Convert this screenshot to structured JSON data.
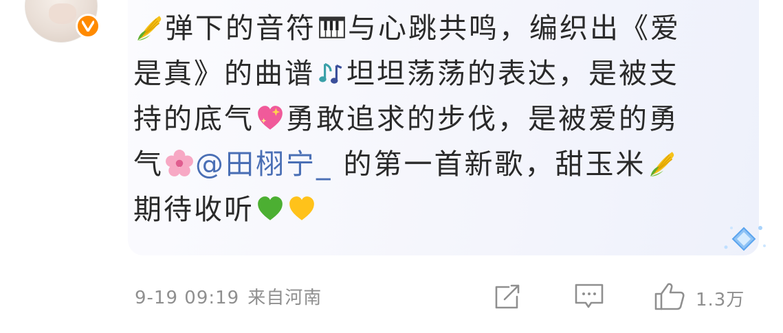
{
  "comment": {
    "lines": [
      [
        "",
        "弹下的音符",
        "",
        "与心跳共鸣，编织出《爱"
      ],
      [
        "是真》的曲谱",
        "",
        "坦坦荡荡的表达，是被支"
      ],
      [
        "持的底气",
        "",
        "勇敢追求的步伐，是被爱的勇"
      ],
      [
        "气",
        "",
        "@田栩宁_",
        " 的第一首新歌，甜玉米",
        ""
      ],
      [
        "期待收听",
        "",
        ""
      ]
    ],
    "line1_seg1": "弹下的音符",
    "line1_seg2": "与心跳共鸣，编织出《爱",
    "line2_seg1": "是真》的曲谱",
    "line2_seg2": "坦坦荡荡的表达，是被支",
    "line3_seg1": "持的底气",
    "line3_seg2": "勇敢追求的步伐，是被爱的勇",
    "line4_seg1": "气",
    "mention": "@田栩宁_",
    "line4_seg2": " 的第一首新歌，甜玉米",
    "line5_seg1": "期待收听",
    "emojis": [
      "corn-emoji",
      "piano-keys-emoji",
      "music-notes-emoji",
      "sparkling-heart-emoji",
      "cherry-blossom-emoji",
      "corn-emoji",
      "green-heart-emoji",
      "yellow-heart-emoji"
    ]
  },
  "meta": {
    "timestamp": "9-19 09:19",
    "source": "来自河南"
  },
  "actions": {
    "like_count": "1.3万"
  },
  "colors": {
    "mention": "#4a6fb5",
    "meta_text": "#8f8f8f",
    "verified_badge": "#ff8a00",
    "bubble_bg": "#f4f5fc"
  }
}
